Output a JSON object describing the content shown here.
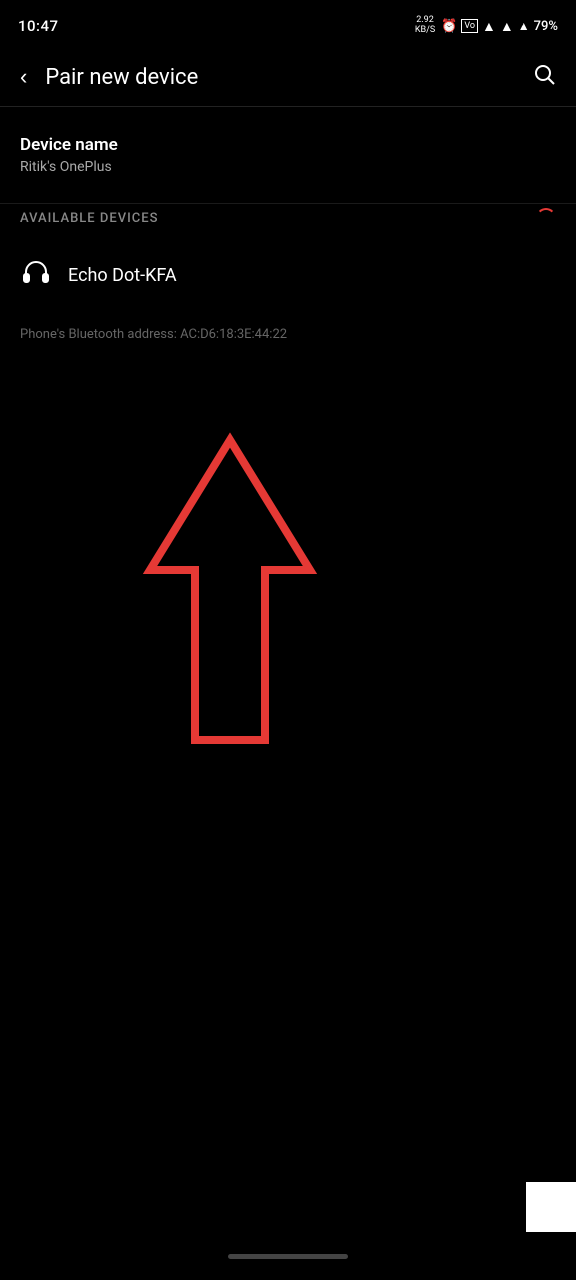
{
  "statusBar": {
    "time": "10:47",
    "networkSpeed": "2.92",
    "networkUnit": "KB/S",
    "battery": "79%"
  },
  "header": {
    "backLabel": "‹",
    "title": "Pair new device",
    "searchIcon": "search"
  },
  "deviceName": {
    "label": "Device name",
    "value": "Ritik's OnePlus"
  },
  "availableDevices": {
    "sectionLabel": "AVAILABLE DEVICES",
    "devices": [
      {
        "name": "Echo Dot-KFA",
        "icon": "🎧"
      }
    ]
  },
  "bluetoothAddress": {
    "text": "Phone's Bluetooth address: AC:D6:18:3E:44:22"
  }
}
